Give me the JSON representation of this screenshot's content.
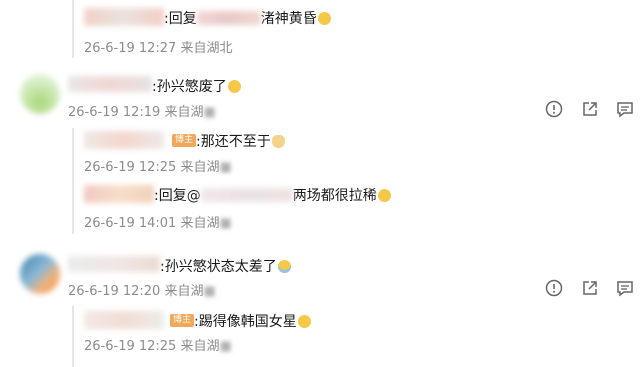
{
  "comments": [
    {
      "kind": "reply",
      "content_prefix": ":回复",
      "content_suffix": "渚神黄昏",
      "emoji": "smile-emoji",
      "date": "26-6-19 12:27",
      "location": "来自湖北"
    },
    {
      "kind": "main",
      "content": ":孙兴慜废了",
      "emoji": "laugh-emoji",
      "date": "26-6-19 12:19",
      "location": "来自湖"
    },
    {
      "kind": "reply",
      "badge": "博主",
      "content": ":那还不至于",
      "emoji": "cat-emoji",
      "date": "26-6-19 12:25",
      "location": "来自湖"
    },
    {
      "kind": "reply",
      "content_prefix": ":回复@",
      "content_suffix": "两场都很拉稀",
      "emoji": "laugh-emoji",
      "date": "26-6-19 14:01",
      "location": "来自湖"
    },
    {
      "kind": "main",
      "content": ":孙兴慜状态太差了",
      "emoji": "sweat-emoji",
      "date": "26-6-19 12:20",
      "location": "来自湖"
    },
    {
      "kind": "reply",
      "badge": "博主",
      "content": ":踢得像韩国女星",
      "emoji": "laugh-emoji",
      "date": "26-6-19 12:25",
      "location": "来自湖"
    }
  ],
  "actions": [
    "report-icon",
    "share-icon",
    "comment-icon"
  ],
  "colors": {
    "meta": "#8c8c8c",
    "text": "#1a1a1a",
    "badge": "#f0a85a",
    "thread_line": "#e6e6e6"
  }
}
